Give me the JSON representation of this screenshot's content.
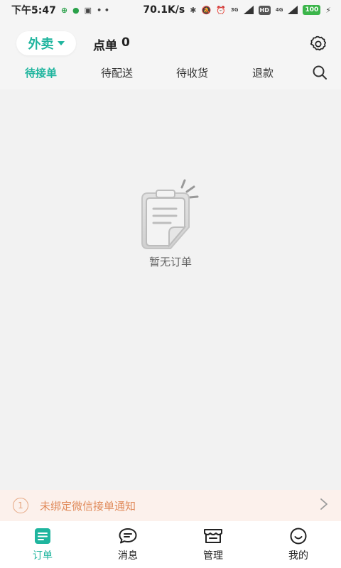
{
  "status_bar": {
    "time": "下午5:47",
    "dots": "• •",
    "net_speed": "70.1K/s",
    "sig_3g": "3G",
    "hd": "HD",
    "sig_4g": "4G",
    "battery": "100"
  },
  "header": {
    "mode_label": "外卖",
    "dine_in_label": "点单",
    "dine_in_count": "0"
  },
  "tabs": [
    {
      "label": "待接单",
      "active": true
    },
    {
      "label": "待配送",
      "active": false
    },
    {
      "label": "待收货",
      "active": false
    },
    {
      "label": "退款",
      "active": false
    }
  ],
  "empty_state": {
    "message": "暂无订单"
  },
  "notice": {
    "icon_text": "1",
    "text": "未绑定微信接单通知"
  },
  "bottom_nav": [
    {
      "label": "订单",
      "icon": "orders-icon",
      "active": true
    },
    {
      "label": "消息",
      "icon": "message-icon",
      "active": false
    },
    {
      "label": "管理",
      "icon": "store-icon",
      "active": false
    },
    {
      "label": "我的",
      "icon": "profile-icon",
      "active": false
    }
  ],
  "colors": {
    "accent": "#1fb59e",
    "notice_text": "#e08a5a",
    "notice_bg": "#fcf1ec"
  }
}
